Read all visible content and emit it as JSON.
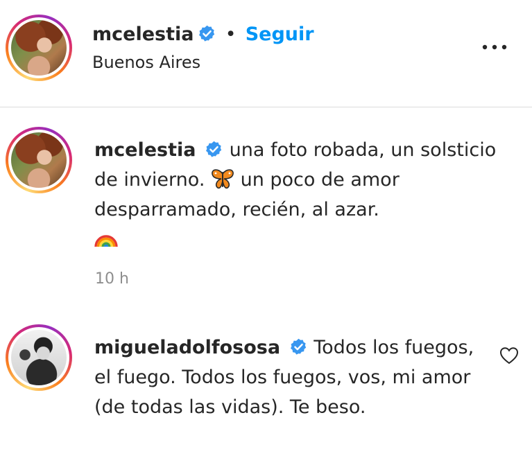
{
  "post_header": {
    "username": "mcelestia",
    "separator": "•",
    "follow_label": "Seguir",
    "location": "Buenos Aires"
  },
  "caption": {
    "username": "mcelestia",
    "text_part1": "una foto robada, un solsticio de invierno.",
    "text_part2": " un poco de amor desparramado, recién, al azar.",
    "timestamp": "10 h"
  },
  "comment": {
    "username": "migueladolfososa",
    "text": "Todos los fuegos, el fuego. Todos los fuegos, vos, mi amor (de todas las vidas). Te beso."
  },
  "colors": {
    "accent": "#0095f6",
    "verified": "#3897f0",
    "text": "#262626",
    "muted": "#8e8e8e"
  },
  "icons": [
    "verified-badge-icon",
    "more-options-icon",
    "butterfly-emoji",
    "rainbow-emoji",
    "heart-icon"
  ]
}
